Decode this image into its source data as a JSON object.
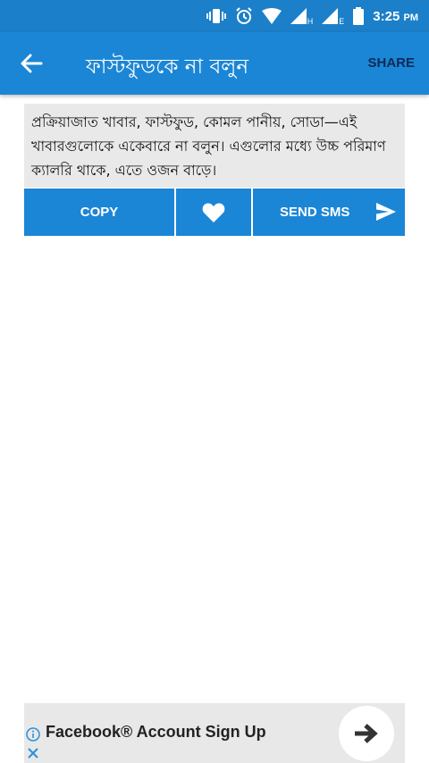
{
  "status_bar": {
    "time": "3:25",
    "ampm": "PM",
    "network_1": "H",
    "network_2": "E",
    "icons": [
      "vibrate-icon",
      "alarm-icon",
      "wifi-icon",
      "signal-icon",
      "signal-icon",
      "battery-icon"
    ]
  },
  "app_bar": {
    "title": "ফাস্টফুডকে না বলুন",
    "share_label": "SHARE",
    "back_icon": "arrow-left-icon",
    "color": "#1b86d6"
  },
  "quote": {
    "text": "প্রক্রিয়াজাত খাবার, ফাস্টফুড, কোমল পানীয়, সোডা—এই খাবারগুলোকে একেবারে না বলুন। এগুলোর মধ্যে উচ্চ পরিমাণ ক্যালরি থাকে, এতে ওজন বাড়ে।"
  },
  "actions": {
    "copy_label": "COPY",
    "favorite_icon": "heart-icon",
    "send_sms_label": "SEND SMS",
    "send_icon": "send-icon"
  },
  "ad": {
    "title": "Facebook® Account Sign Up",
    "info_icon": "info-icon",
    "close_icon": "close-icon",
    "arrow_icon": "arrow-right-icon"
  }
}
